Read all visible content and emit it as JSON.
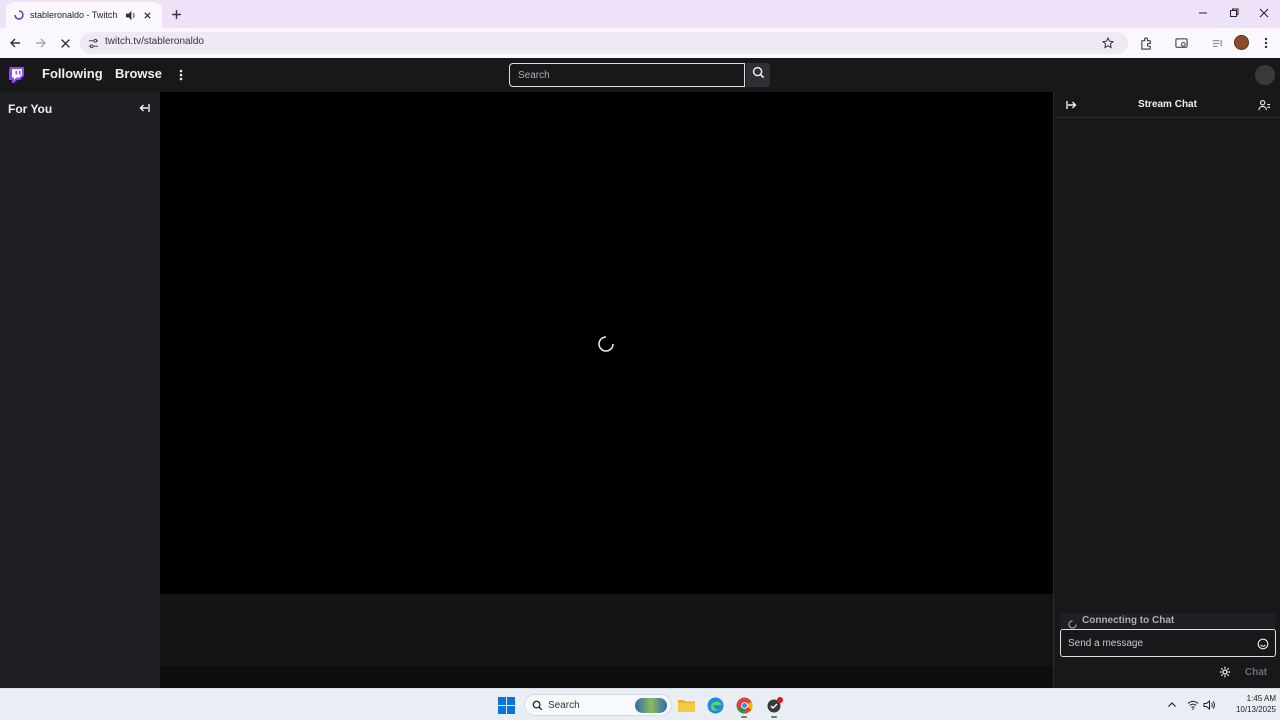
{
  "browser": {
    "tab_title": "stableronaldo - Twitch",
    "url": "twitch.tv/stableronaldo"
  },
  "twitch": {
    "nav": {
      "following": "Following",
      "browse": "Browse",
      "search_placeholder": "Search"
    },
    "sidebar": {
      "heading": "For You"
    },
    "chat": {
      "title": "Stream Chat",
      "status": "Connecting to Chat",
      "message_placeholder": "Send a message",
      "send_label": "Chat"
    }
  },
  "taskbar": {
    "search_label": "Search",
    "time": "1:45 AM",
    "date": "10/13/2025"
  },
  "colors": {
    "twitch_purple": "#9146ff",
    "chrome_frame": "#efe1f7",
    "page_bg": "#0e0e10"
  },
  "icons": [
    "twitch-logo",
    "search-icon",
    "more-vertical-icon",
    "collapse-left-icon",
    "collapse-right-icon",
    "community-icon",
    "emote-icon",
    "gear-icon",
    "loading-spinner"
  ]
}
